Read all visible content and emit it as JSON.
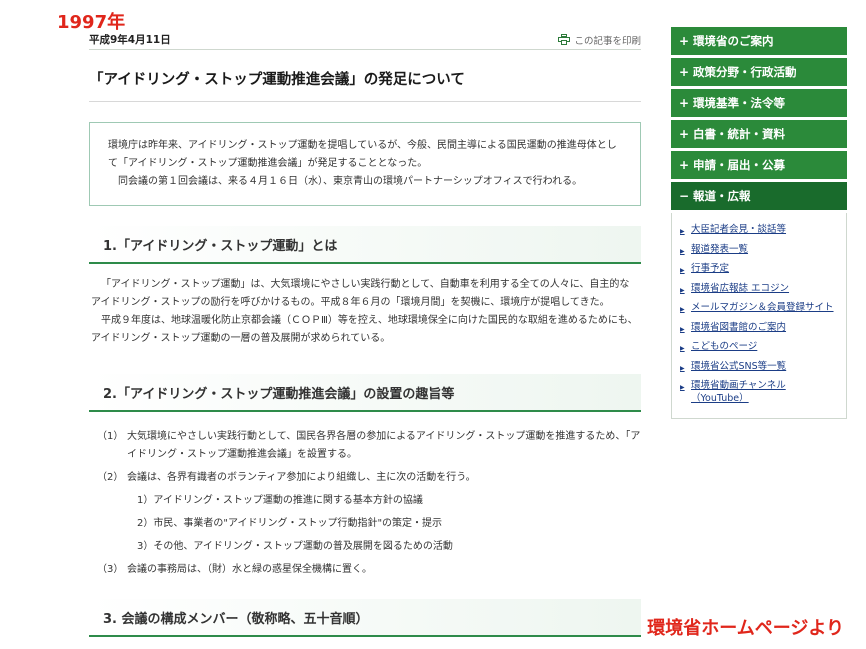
{
  "overlay": {
    "year": "1997年",
    "source": "環境省ホームページより"
  },
  "article": {
    "date": "平成9年4月11日",
    "print_label": "この記事を印刷",
    "title": "「アイドリング・ストップ運動推進会議」の発足について",
    "summary": [
      "環境庁は昨年来、アイドリング・ストップ運動を提唱しているが、今般、民間主導による国民運動の推進母体として「アイドリング・ストップ運動推進会議」が発足することとなった。",
      "同会議の第１回会議は、来る４月１６日（水）、東京青山の環境パートナーシップオフィスで行われる。"
    ],
    "section1": {
      "heading": "1.「アイドリング・ストップ運動」とは",
      "paragraphs": [
        "「アイドリング・ストップ運動」は、大気環境にやさしい実践行動として、自動車を利用する全ての人々に、自主的なアイドリング・ストップの励行を呼びかけるもの。平成８年６月の「環境月間」を契機に、環境庁が提唱してきた。",
        "平成９年度は、地球温暖化防止京都会議（ＣＯＰⅢ）等を控え、地球環境保全に向けた国民的な取組を進めるためにも、アイドリング・ストップ運動の一層の普及展開が求められている。"
      ]
    },
    "section2": {
      "heading": "2.「アイドリング・ストップ運動推進会議」の設置の趣旨等",
      "items": [
        {
          "mark": "（1）",
          "text": "大気環境にやさしい実践行動として、国民各界各層の参加によるアイドリング・ストップ運動を推進するため、「アイドリング・ストップ運動推進会議」を設置する。"
        },
        {
          "mark": "（2）",
          "text": "会議は、各界有識者のボランティア参加により組織し、主に次の活動を行う。"
        },
        {
          "mark": "（3）",
          "text": "会議の事務局は、（財）水と緑の惑星保全機構に置く。"
        }
      ],
      "subitems": [
        "1）アイドリング・ストップ運動の推進に関する基本方針の協議",
        "2）市民、事業者の\"アイドリング・ストップ行動指針\"の策定・提示",
        "3）その他、アイドリング・ストップ運動の普及展開を図るための活動"
      ]
    },
    "section3": {
      "heading": "3. 会議の構成メンバー（敬称略、五十音順）"
    }
  },
  "sidebar": {
    "menu": [
      {
        "mark": "+",
        "label": "環境省のご案内"
      },
      {
        "mark": "+",
        "label": "政策分野・行政活動"
      },
      {
        "mark": "+",
        "label": "環境基準・法令等"
      },
      {
        "mark": "+",
        "label": "白書・統計・資料"
      },
      {
        "mark": "+",
        "label": "申請・届出・公募"
      },
      {
        "mark": "−",
        "label": "報道・広報"
      }
    ],
    "sublinks": [
      "大臣記者会見・談話等",
      "報道発表一覧",
      "行事予定",
      "環境省広報誌 エコジン",
      "メールマガジン＆会員登録サイト",
      "環境省図書館のご案内",
      "こどものページ",
      "環境省公式SNS等一覧",
      "環境省動画チャンネル（YouTube）"
    ]
  },
  "colors": {
    "accent_green": "#2b8a3a",
    "active_green": "#196b2c",
    "link_blue": "#1b3d86",
    "stamp_red": "#e0261b"
  }
}
